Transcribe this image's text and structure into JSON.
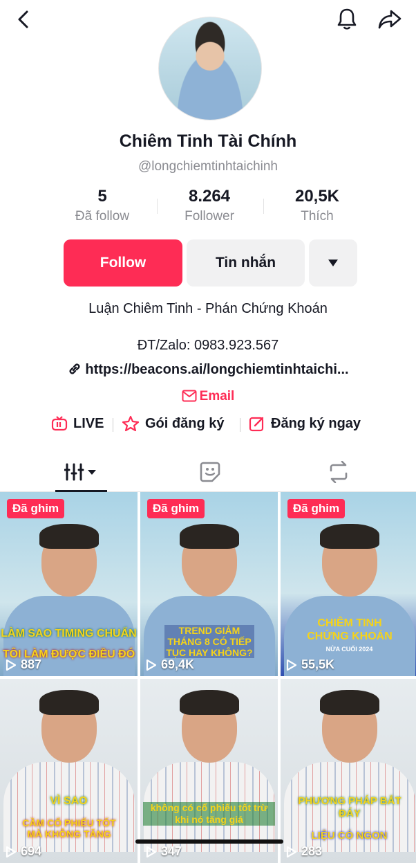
{
  "profile": {
    "name": "Chiêm Tinh Tài Chính",
    "handle": "@longchiemtinhtaichinh",
    "stats": [
      {
        "value": "5",
        "label": "Đã follow"
      },
      {
        "value": "8.264",
        "label": "Follower"
      },
      {
        "value": "20,5K",
        "label": "Thích"
      }
    ],
    "buttons": {
      "follow": "Follow",
      "message": "Tin nhắn"
    },
    "bio_line1": "Luận Chiêm Tinh - Phán Chứng Khoán",
    "bio_line2": "ĐT/Zalo: 0983.923.567",
    "link": "https://beacons.ai/longchiemtinhtaichi...",
    "email": "Email",
    "features": {
      "live": "LIVE",
      "subscription": "Gói đăng ký",
      "register": "Đăng ký ngay"
    }
  },
  "icons": [
    "back-icon",
    "bell-icon",
    "share-icon",
    "dropdown-triangle-icon",
    "link-icon",
    "mail-icon",
    "live-tv-icon",
    "subscription-icon",
    "edit-icon",
    "grid-icon",
    "sticker-icon",
    "repost-icon",
    "play-icon"
  ],
  "accent_color": "#fe2c55",
  "videos": [
    {
      "pinned": "Đã ghim",
      "views": "887",
      "cap1": "LÀM SAO TIMING CHUẨN",
      "cap2": "TÔI LÀM ĐƯỢC ĐIỀU ĐÓ"
    },
    {
      "pinned": "Đã ghim",
      "views": "69,4K",
      "cap1": "TREND GIẢM THÁNG 8 CÓ TIẾP TỤC HAY KHÔNG?",
      "cap2": ""
    },
    {
      "pinned": "Đã ghim",
      "views": "55,5K",
      "cap1": "CHIÊM TINH CHỨNG KHOÁN",
      "cap2": "NỬA CUỐI 2024"
    },
    {
      "pinned": "",
      "views": "694",
      "cap1": "VÌ SAO",
      "cap2": "CẦM CỔ PHIẾU TỐT MÀ KHÔNG TĂNG"
    },
    {
      "pinned": "",
      "views": "347",
      "cap1": "không có cổ phiếu tốt trừ khi nó tăng giá",
      "cap2": ""
    },
    {
      "pinned": "",
      "views": "283",
      "cap1": "PHƯƠNG PHÁP BẮT ĐÁY",
      "cap2": "LIỆU CÓ NGON"
    }
  ]
}
